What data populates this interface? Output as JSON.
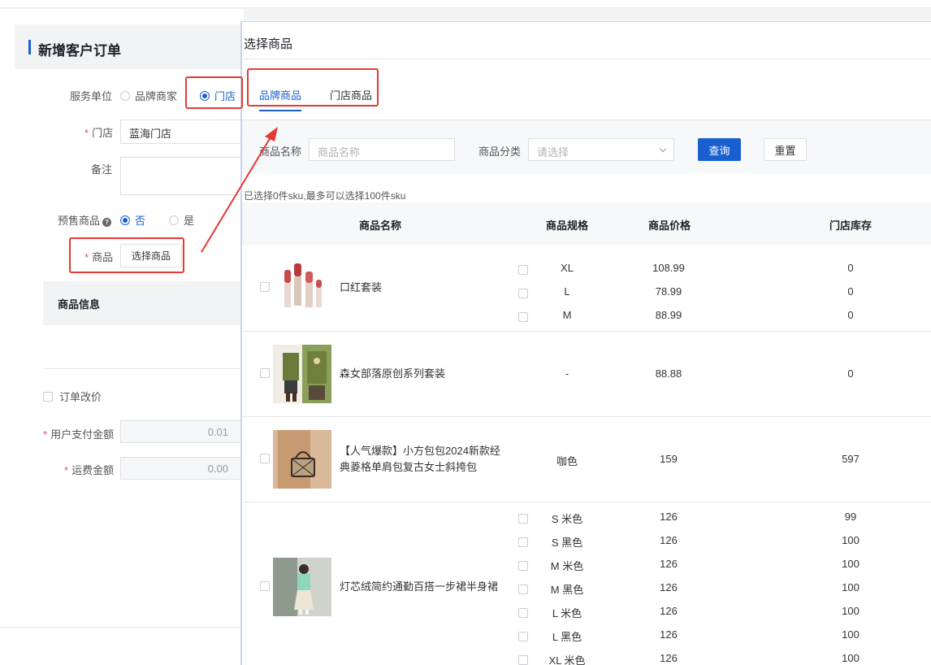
{
  "form": {
    "title": "新增客户订单",
    "service_unit": {
      "label": "服务单位",
      "options": [
        "品牌商家",
        "门店"
      ],
      "selected": "门店"
    },
    "store": {
      "label": "门店",
      "value": "蓝海门店"
    },
    "remark": {
      "label": "备注"
    },
    "presale": {
      "label": "预售商品",
      "options": [
        "否",
        "是"
      ],
      "selected": "否"
    },
    "goods": {
      "label": "商品",
      "button": "选择商品"
    },
    "goods_info_header": "商品信息",
    "order_price_change": "订单改价",
    "user_pay": {
      "label": "用户支付金额",
      "value": "0.01"
    },
    "shipping": {
      "label": "运费金额",
      "value": "0.00"
    }
  },
  "modal": {
    "title": "选择商品",
    "tabs": [
      "品牌商品",
      "门店商品"
    ],
    "active_tab": "品牌商品",
    "filter": {
      "name_label": "商品名称",
      "name_placeholder": "商品名称",
      "category_label": "商品分类",
      "category_placeholder": "请选择",
      "query": "查询",
      "reset": "重置"
    },
    "selection_info": "已选择0件sku,最多可以选择100件sku",
    "columns": [
      "商品名称",
      "商品规格",
      "商品价格",
      "门店库存"
    ],
    "products": [
      {
        "name": "口红套装",
        "image": "lipstick-image",
        "skus": [
          {
            "spec": "XL",
            "price": "108.99",
            "stock": "0"
          },
          {
            "spec": "L",
            "price": "78.99",
            "stock": "0"
          },
          {
            "spec": "M",
            "price": "88.99",
            "stock": "0"
          }
        ]
      },
      {
        "name": "森女部落原创系列套装",
        "image": "outfit-image",
        "skus": [
          {
            "spec": "-",
            "price": "88.88",
            "stock": "0"
          }
        ]
      },
      {
        "name_line1": "【人气爆款】小方包包2024新款经",
        "name_line2": "典菱格单肩包复古女士斜挎包",
        "image": "bag-image",
        "skus": [
          {
            "spec": "咖色",
            "price": "159",
            "stock": "597"
          }
        ]
      },
      {
        "name": "灯芯绒简约通勤百搭一步裙半身裙",
        "image": "skirt-image",
        "skus": [
          {
            "spec": "S 米色",
            "price": "126",
            "stock": "99"
          },
          {
            "spec": "S 黑色",
            "price": "126",
            "stock": "100"
          },
          {
            "spec": "M 米色",
            "price": "126",
            "stock": "100"
          },
          {
            "spec": "M 黑色",
            "price": "126",
            "stock": "100"
          },
          {
            "spec": "L 米色",
            "price": "126",
            "stock": "100"
          },
          {
            "spec": "L 黑色",
            "price": "126",
            "stock": "100"
          },
          {
            "spec": "XL 米色",
            "price": "126",
            "stock": "100"
          }
        ]
      }
    ]
  },
  "colors": {
    "primary": "#1a5fd0",
    "highlight": "#e53935",
    "required": "#e34d59"
  }
}
